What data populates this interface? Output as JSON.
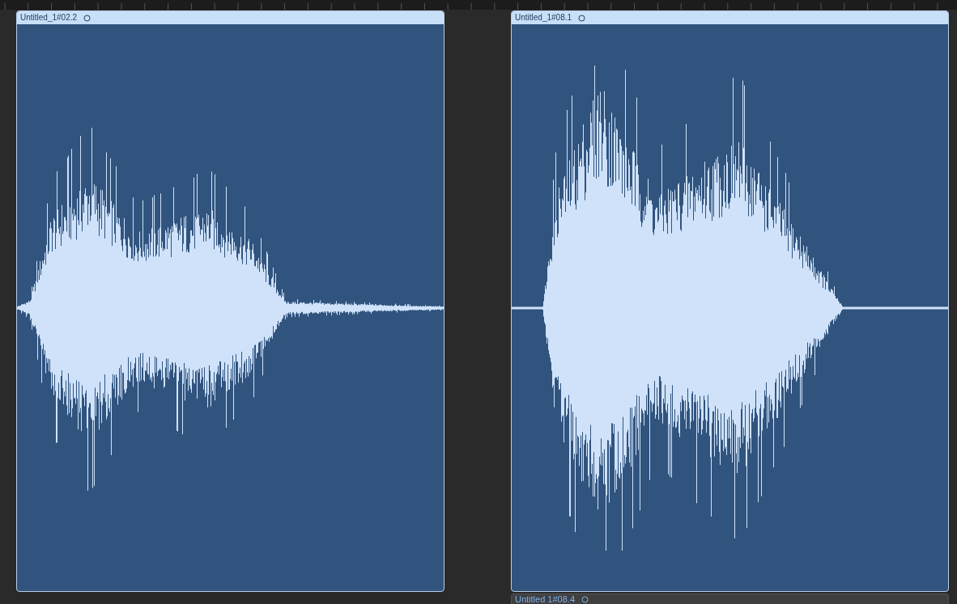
{
  "regions": [
    {
      "title": "Untitled_1#02.2"
    },
    {
      "title": "Untitled_1#08.1"
    },
    {
      "title": "Untitled 1#08.4"
    }
  ]
}
